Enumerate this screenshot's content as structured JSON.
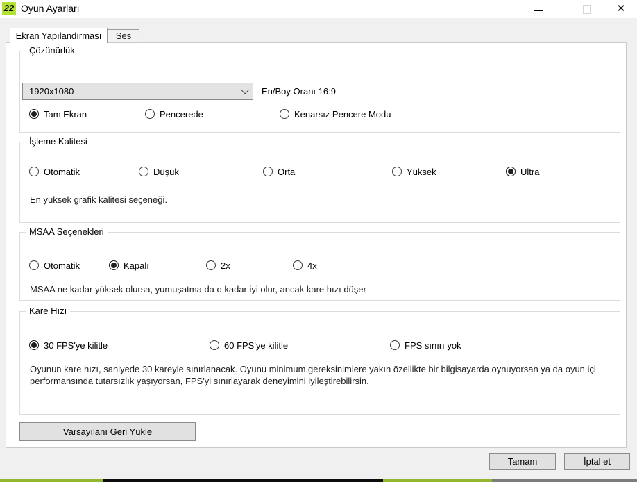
{
  "window": {
    "icon_text": "22",
    "title": "Oyun Ayarları",
    "close_glyph": "✕"
  },
  "tabs": [
    {
      "label": "Ekran Yapılandırması",
      "active": true
    },
    {
      "label": "Ses",
      "active": false
    }
  ],
  "resolution": {
    "title": "Çözünürlük",
    "dropdown_value": "1920x1080",
    "aspect_ratio_label": "En/Boy Oranı 16:9",
    "options": [
      {
        "label": "Tam Ekran",
        "selected": true
      },
      {
        "label": "Pencerede",
        "selected": false
      },
      {
        "label": "Kenarsız Pencere Modu",
        "selected": false
      }
    ]
  },
  "render_quality": {
    "title": "İşleme Kalitesi",
    "options": [
      {
        "label": "Otomatik",
        "selected": false
      },
      {
        "label": "Düşük",
        "selected": false
      },
      {
        "label": "Orta",
        "selected": false
      },
      {
        "label": "Yüksek",
        "selected": false
      },
      {
        "label": "Ultra",
        "selected": true
      }
    ],
    "help": "En yüksek grafik kalitesi seçeneği."
  },
  "msaa": {
    "title": "MSAA Seçenekleri",
    "options": [
      {
        "label": "Otomatik",
        "selected": false
      },
      {
        "label": "Kapalı",
        "selected": true
      },
      {
        "label": "2x",
        "selected": false
      },
      {
        "label": "4x",
        "selected": false
      }
    ],
    "help": "MSAA ne kadar yüksek olursa, yumuşatma da o kadar iyi olur, ancak kare hızı düşer"
  },
  "framerate": {
    "title": "Kare Hızı",
    "options": [
      {
        "label": "30 FPS'ye kilitle",
        "selected": true
      },
      {
        "label": "60 FPS'ye kilitle",
        "selected": false
      },
      {
        "label": "FPS sınırı yok",
        "selected": false
      }
    ],
    "help": "Oyunun kare hızı, saniyede 30 kareyle sınırlanacak. Oyunu minimum gereksinimlere yakın özellikte bir bilgisayarda oynuyorsan ya da oyun içi performansında tutarsızlık yaşıyorsan, FPS'yi sınırlayarak deneyimini iyileştirebilirsin."
  },
  "buttons": {
    "restore_defaults": "Varsayılanı Geri Yükle",
    "ok": "Tamam",
    "cancel": "İptal et"
  },
  "colors": {
    "icon_green": "#b3e136",
    "strip_green": "#94b530",
    "strip_black": "#0c0c0c",
    "strip_gray": "#7d7d7d"
  }
}
